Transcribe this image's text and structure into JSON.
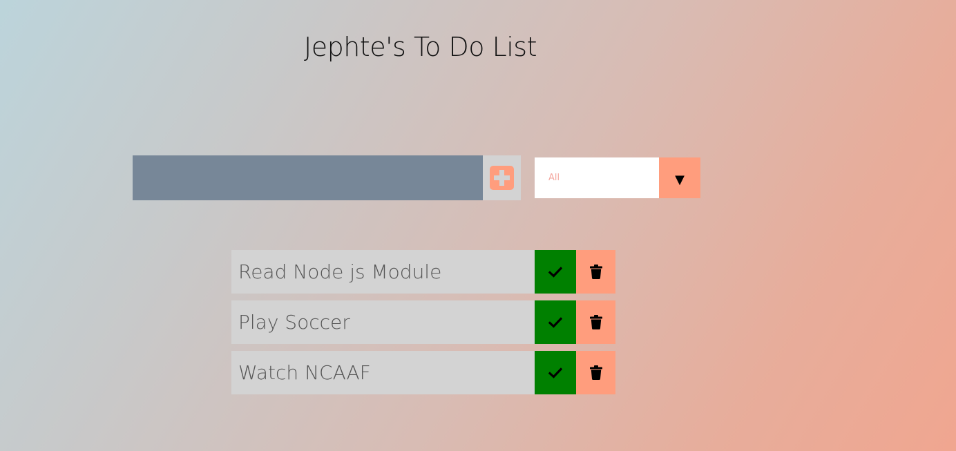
{
  "header": {
    "title": "Jephte's To Do List"
  },
  "form": {
    "input_value": "",
    "input_placeholder": "",
    "add_icon": "plus-square-icon"
  },
  "filter": {
    "selected": "All",
    "arrow": "▼"
  },
  "todos": [
    {
      "text": "Read Node js Module",
      "complete_icon": "check-icon",
      "delete_icon": "trash-icon"
    },
    {
      "text": "Play Soccer",
      "complete_icon": "check-icon",
      "delete_icon": "trash-icon"
    },
    {
      "text": "Watch NCAAF",
      "complete_icon": "check-icon",
      "delete_icon": "trash-icon"
    }
  ],
  "colors": {
    "accent": "#ff9d7d",
    "complete": "#008000",
    "input_bg": "#778798",
    "item_bg": "#d3d3d3"
  }
}
